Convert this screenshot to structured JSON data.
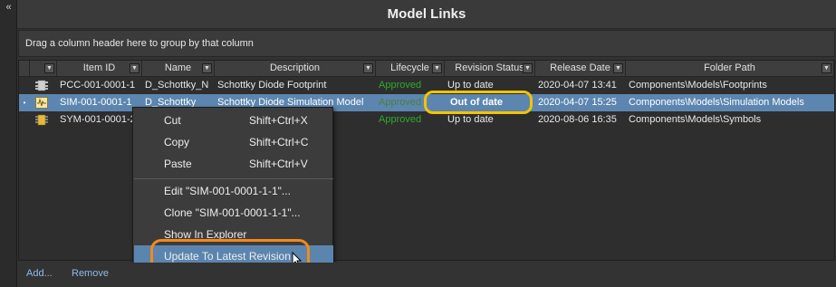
{
  "panel": {
    "collapse_glyph": "«",
    "title": "Model Links",
    "group_hint": "Drag a column header here to group by that column"
  },
  "columns": [
    "Item ID",
    "Name",
    "Description",
    "Lifecycle",
    "Revision Status",
    "Release Date",
    "Folder Path"
  ],
  "rows": [
    {
      "icon": "footprint-icon",
      "item_id": "PCC-001-0001-1",
      "name": "D_Schottky_N",
      "description": "Schottky Diode Footprint",
      "lifecycle": "Approved",
      "revision_status": "Up to date",
      "release_date": "2020-04-07 13:41",
      "folder_path": "Components\\Models\\Footprints"
    },
    {
      "icon": "simulation-model-icon",
      "item_id": "SIM-001-0001-1",
      "name": "D_Schottky",
      "description": "Schottky Diode Simulation Model",
      "lifecycle": "Approved",
      "revision_status": "Out of date",
      "release_date": "2020-04-07 15:25",
      "folder_path": "Components\\Models\\Simulation Models"
    },
    {
      "icon": "symbol-icon",
      "item_id": "SYM-001-0001-2",
      "name": "",
      "description": "",
      "lifecycle": "Approved",
      "revision_status": "Up to date",
      "release_date": "2020-08-06 16:35",
      "folder_path": "Components\\Models\\Symbols"
    }
  ],
  "context_menu": {
    "cut": {
      "label": "Cut",
      "shortcut": "Shift+Ctrl+X"
    },
    "copy": {
      "label": "Copy",
      "shortcut": "Shift+Ctrl+C"
    },
    "paste": {
      "label": "Paste",
      "shortcut": "Shift+Ctrl+V"
    },
    "edit": {
      "label": "Edit \"SIM-001-0001-1-1\"..."
    },
    "clone": {
      "label": "Clone \"SIM-001-0001-1-1\"..."
    },
    "show_in_explorer": {
      "label": "Show In Explorer"
    },
    "update_latest": {
      "label": "Update To Latest Revision"
    }
  },
  "footer": {
    "add_label": "Add...",
    "remove_label": "Remove"
  },
  "colors": {
    "selection": "#5c86b0",
    "lifecycle_green": "#2eaa2e",
    "highlight_yellow": "#f3c300",
    "highlight_orange": "#f28a1c",
    "link_blue": "#8fbbe8"
  }
}
